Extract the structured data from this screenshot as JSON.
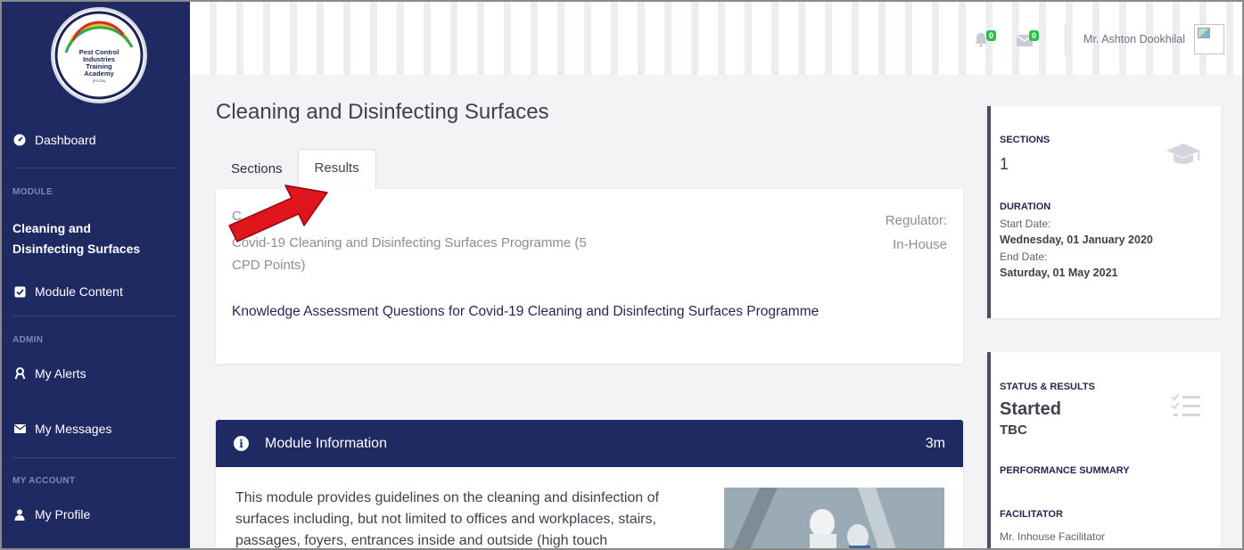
{
  "sidebar": {
    "logo": {
      "lines": [
        "Pest Control",
        "Industries",
        "Training",
        "Academy"
      ],
      "small": "(PCITA)"
    },
    "dashboard": "Dashboard",
    "module_section": "MODULE",
    "module_title_line1": "Cleaning and",
    "module_title_line2": "Disinfecting Surfaces",
    "module_content": "Module Content",
    "admin_section": "ADMIN",
    "my_alerts": "My Alerts",
    "my_messages": "My Messages",
    "account_section": "MY ACCOUNT",
    "my_profile": "My Profile"
  },
  "topbar": {
    "alerts_count": "0",
    "messages_count": "0",
    "user_name": "Mr. Ashton Dookhilal"
  },
  "main": {
    "title": "Cleaning and Disinfecting Surfaces",
    "tabs": [
      {
        "label": "Sections"
      },
      {
        "label": "Results"
      }
    ],
    "active_tab": "Results",
    "course_label": "C",
    "course_name": "Covid-19 Cleaning and Disinfecting Surfaces Programme (5 CPD Points)",
    "regulator_label": "Regulator:",
    "regulator_value": "In-House",
    "assessment_title": "Knowledge Assessment Questions for Covid-19 Cleaning and Disinfecting Surfaces Programme"
  },
  "module_info": {
    "heading": "Module Information",
    "duration": "3m",
    "description": "This module provides guidelines on the cleaning and disinfection of surfaces including, but not limited to offices and workplaces, stairs, passages, foyers, entrances inside and outside (high touch"
  },
  "summary": {
    "sections_label": "SECTIONS",
    "sections_value": "1",
    "duration_label": "DURATION",
    "start_label": "Start Date:",
    "start_value": "Wednesday, 01 January 2020",
    "end_label": "End Date:",
    "end_value": "Saturday, 01 May 2021"
  },
  "status": {
    "label": "STATUS & RESULTS",
    "state": "Started",
    "result": "TBC",
    "performance_label": "PERFORMANCE SUMMARY",
    "facilitator_label": "FACILITATOR",
    "facilitator_value": "Mr. Inhouse Facilitator"
  },
  "colors": {
    "sidebar": "#1f2a63",
    "badge": "#2ebd4e",
    "annotation_arrow": "#e0141b"
  }
}
